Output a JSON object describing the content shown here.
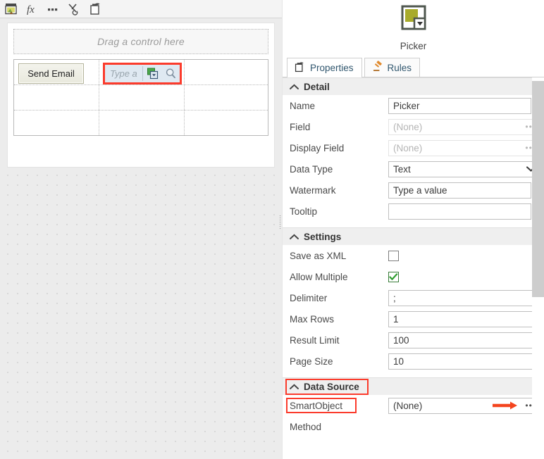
{
  "designer": {
    "toolbar": {
      "buttons": [
        {
          "name": "save-image-icon",
          "label": "Save"
        },
        {
          "name": "function-icon",
          "label": "fx"
        },
        {
          "name": "ellipsis-icon",
          "label": "..."
        },
        {
          "name": "cut-refresh-icon",
          "label": "Cut"
        },
        {
          "name": "paste-icon",
          "label": "Paste"
        }
      ]
    },
    "canvas": {
      "dropzone_text": "Drag a control here",
      "table": {
        "rows": [
          {
            "cells": [
              {
                "type": "button",
                "label": "Send Email"
              },
              {
                "type": "picker",
                "placeholder": "Type a",
                "selected": true,
                "highlight_color": "#fb3b2c"
              },
              {
                "type": "empty",
                "label": ""
              }
            ]
          },
          {
            "cells": [
              {
                "type": "empty",
                "label": ""
              },
              {
                "type": "empty",
                "label": ""
              },
              {
                "type": "empty",
                "label": ""
              }
            ]
          },
          {
            "cells": [
              {
                "type": "empty",
                "label": ""
              },
              {
                "type": "empty",
                "label": ""
              },
              {
                "type": "empty",
                "label": ""
              }
            ]
          }
        ]
      }
    }
  },
  "properties_panel": {
    "header": {
      "icon": "picker-control-icon",
      "title": "Picker"
    },
    "tabs": [
      {
        "label": "Properties",
        "icon": "properties-icon",
        "active": true
      },
      {
        "label": "Rules",
        "icon": "gavel-icon",
        "active": false
      }
    ],
    "sections": [
      {
        "id": "detail",
        "title": "Detail",
        "collapsed": false,
        "highlighted": false,
        "rows": [
          {
            "label": "Name",
            "value": "Picker",
            "control": "text",
            "placeholder": "",
            "muted": false
          },
          {
            "label": "Field",
            "value": "(None)",
            "control": "picker",
            "muted": true
          },
          {
            "label": "Display Field",
            "value": "(None)",
            "control": "picker",
            "muted": true
          },
          {
            "label": "Data Type",
            "value": "Text",
            "control": "dropdown",
            "muted": false
          },
          {
            "label": "Watermark",
            "value": "Type a value",
            "control": "text",
            "muted": false
          },
          {
            "label": "Tooltip",
            "value": "",
            "control": "text",
            "muted": false
          }
        ]
      },
      {
        "id": "settings",
        "title": "Settings",
        "collapsed": false,
        "highlighted": false,
        "rows": [
          {
            "label": "Save as XML",
            "value": "",
            "control": "checkbox",
            "checked": false
          },
          {
            "label": "Allow Multiple",
            "value": "",
            "control": "checkbox",
            "checked": true
          },
          {
            "label": "Delimiter",
            "value": ";",
            "control": "text",
            "muted": false
          },
          {
            "label": "Max Rows",
            "value": "1",
            "control": "text",
            "muted": false
          },
          {
            "label": "Result Limit",
            "value": "100",
            "control": "text",
            "muted": false
          },
          {
            "label": "Page Size",
            "value": "10",
            "control": "text",
            "muted": false
          }
        ]
      },
      {
        "id": "data-source",
        "title": "Data Source",
        "collapsed": false,
        "highlighted": true,
        "rows": [
          {
            "label": "SmartObject",
            "value": "(None)",
            "control": "picker-arrow",
            "muted": false,
            "label_highlighted": true
          },
          {
            "label": "Method",
            "value": "",
            "control": "none",
            "muted": false
          }
        ]
      }
    ],
    "scrollbar": {
      "visible": true
    }
  },
  "colors": {
    "highlight_red": "#fb3b2c",
    "accent_olive": "#a8ab2b",
    "tab_text": "#30566e",
    "panel_section_bg": "#efefef",
    "canvas_bg": "#ececec"
  }
}
